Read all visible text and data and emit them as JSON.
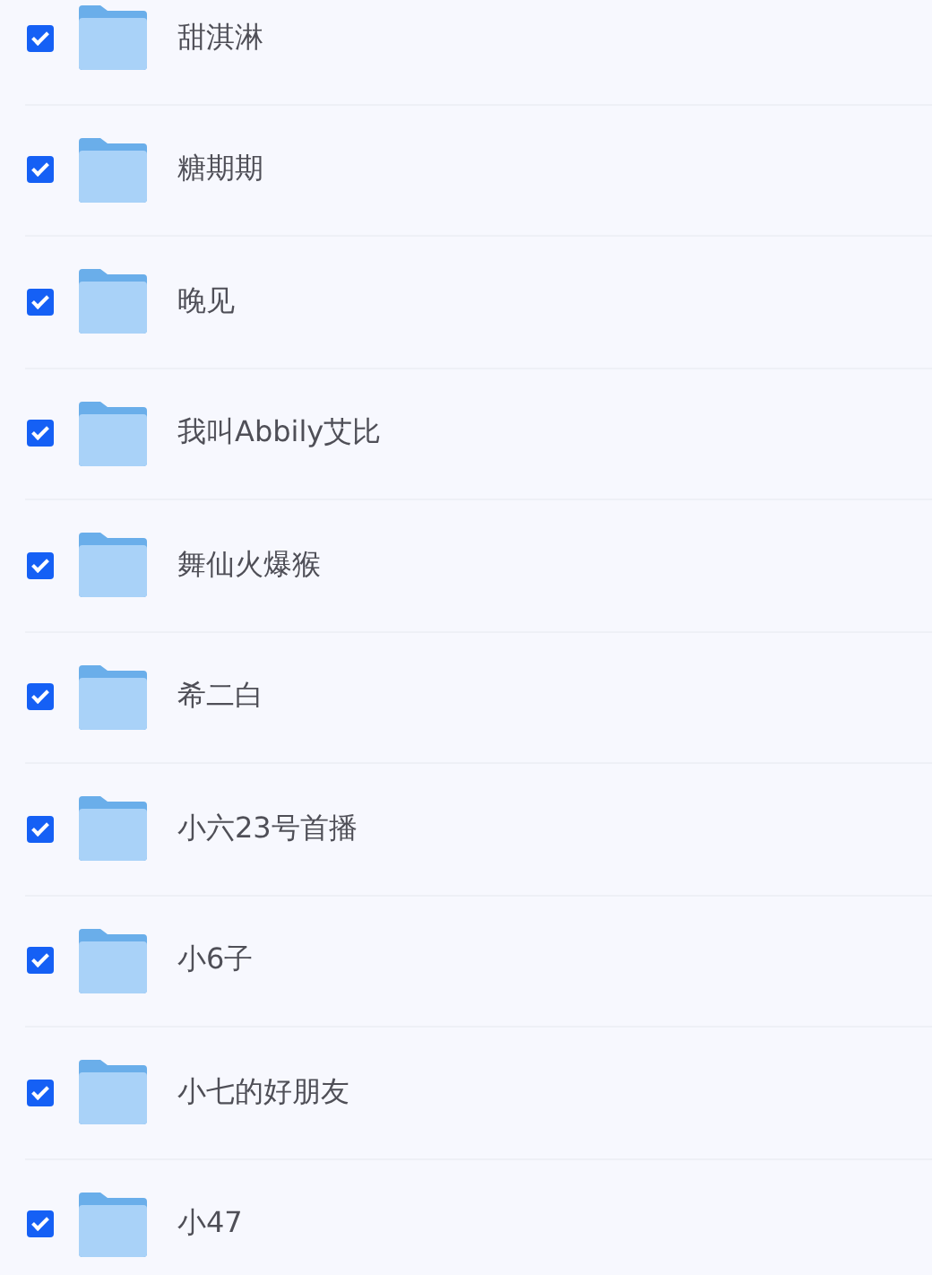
{
  "folders": [
    {
      "name": "甜淇淋",
      "checked": true
    },
    {
      "name": "糖期期",
      "checked": true
    },
    {
      "name": "晚见",
      "checked": true
    },
    {
      "name": "我叫Abbily艾比",
      "checked": true
    },
    {
      "name": "舞仙火爆猴",
      "checked": true
    },
    {
      "name": "希二白",
      "checked": true
    },
    {
      "name": "小六23号首播",
      "checked": true
    },
    {
      "name": "小6子",
      "checked": true
    },
    {
      "name": "小七的好朋友",
      "checked": true
    },
    {
      "name": "小47",
      "checked": true
    }
  ]
}
